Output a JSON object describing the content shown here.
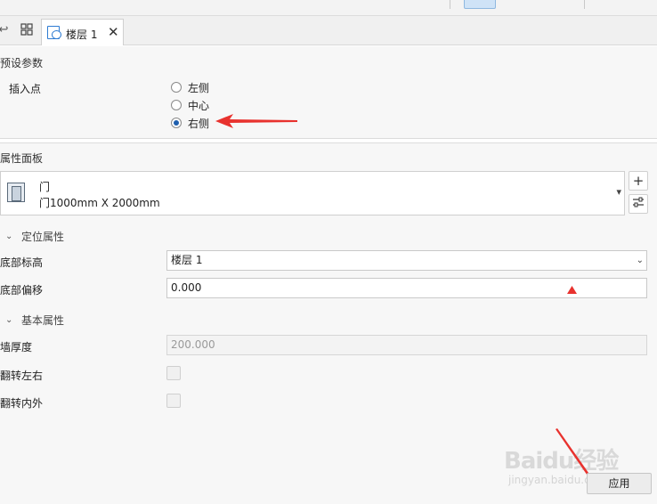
{
  "tabbar": {
    "active_tab": "楼层 1",
    "close_glyph": "✕"
  },
  "preset": {
    "title": "预设参数",
    "insert_point_label": "插入点",
    "options": [
      {
        "label": "左侧",
        "checked": false
      },
      {
        "label": "中心",
        "checked": false
      },
      {
        "label": "右侧",
        "checked": true
      }
    ]
  },
  "properties": {
    "title": "属性面板",
    "type_name": "门",
    "type_desc": "门1000mm X 2000mm",
    "add_glyph": "+",
    "settings_glyph": "⚟",
    "positioning_group": "定位属性",
    "basic_group": "基本属性",
    "base_level_label": "底部标高",
    "base_level_value": "楼层 1",
    "base_offset_label": "底部偏移",
    "base_offset_value": "0.000",
    "wall_thickness_label": "墙厚度",
    "wall_thickness_value": "200.000",
    "flip_lr_label": "翻转左右",
    "flip_io_label": "翻转内外",
    "apply_label": "应用"
  },
  "watermark": {
    "logo": "Baidu经验",
    "url": "jingyan.baidu.com"
  },
  "colors": {
    "accent": "#1f5fae",
    "arrow_red": "#e8322e"
  }
}
